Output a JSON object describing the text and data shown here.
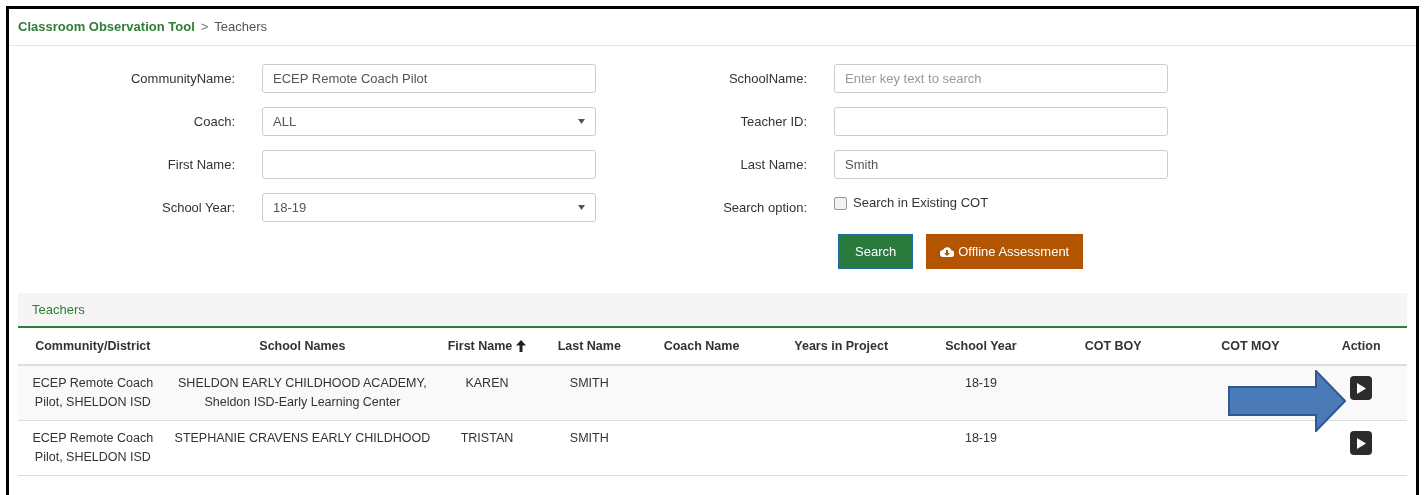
{
  "breadcrumb": {
    "app": "Classroom Observation Tool",
    "separator": ">",
    "page": "Teachers"
  },
  "filters_left": [
    {
      "label": "CommunityName:",
      "kind": "text",
      "value": "ECEP Remote Coach Pilot"
    },
    {
      "label": "Coach:",
      "kind": "select",
      "value": "ALL"
    },
    {
      "label": "First Name:",
      "kind": "text"
    },
    {
      "label": "School Year:",
      "kind": "select",
      "value": "18-19"
    }
  ],
  "filters_right": [
    {
      "label": "SchoolName:",
      "kind": "text",
      "placeholder": "Enter key text to search"
    },
    {
      "label": "Teacher ID:",
      "kind": "text"
    },
    {
      "label": "Last Name:",
      "kind": "text",
      "value": "Smith"
    },
    {
      "label": "Search option:",
      "kind": "checkbox",
      "option": "Search in Existing COT",
      "checked": false
    }
  ],
  "buttons": [
    {
      "label": "Search",
      "kind": "primary"
    },
    {
      "label": "Offline Assessment",
      "kind": "download"
    }
  ],
  "table": {
    "title": "Teachers",
    "columns": [
      {
        "label": "Community/District",
        "sorted": false
      },
      {
        "label": "School Names",
        "sorted": false
      },
      {
        "label": "First Name",
        "sorted": true
      },
      {
        "label": "Last Name",
        "sorted": false
      },
      {
        "label": "Coach Name",
        "sorted": false
      },
      {
        "label": "Years in Project",
        "sorted": false
      },
      {
        "label": "School Year",
        "sorted": false
      },
      {
        "label": "COT BOY",
        "sorted": false
      },
      {
        "label": "COT MOY",
        "sorted": false
      },
      {
        "label": "Action",
        "sorted": false
      }
    ],
    "rows": [
      {
        "community": "ECEP Remote Coach Pilot, SHELDON ISD",
        "school": "SHELDON EARLY CHILDHOOD ACADEMY, Sheldon ISD-Early Learning Center",
        "first_name": "KAREN",
        "last_name": "SMITH",
        "school_year": "18-19"
      },
      {
        "community": "ECEP Remote Coach Pilot, SHELDON ISD",
        "school": "STEPHANIE CRAVENS EARLY CHILDHOOD",
        "first_name": "TRISTAN",
        "last_name": "SMITH",
        "school_year": "18-19"
      }
    ]
  }
}
